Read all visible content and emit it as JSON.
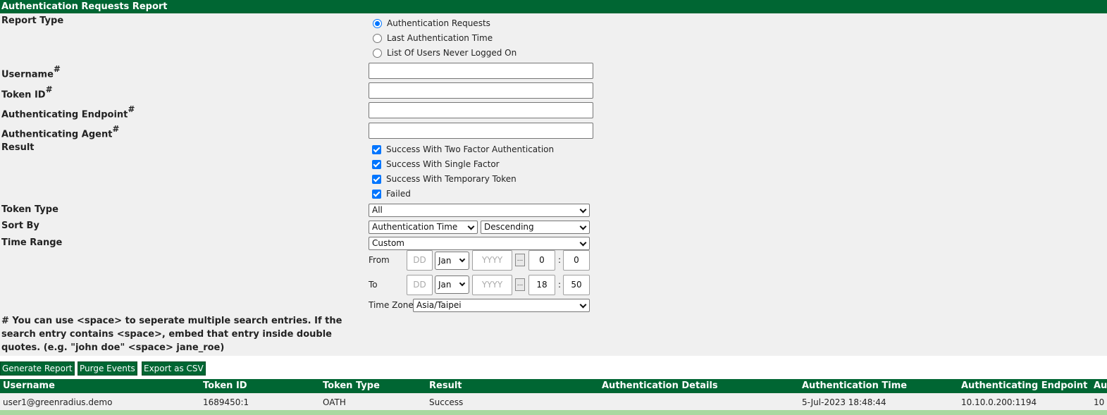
{
  "title": "Authentication Requests Report",
  "labels": {
    "report_type": "Report Type",
    "username": "Username",
    "token_id": "Token ID",
    "endpoint": "Authenticating Endpoint",
    "agent": "Authenticating Agent",
    "result": "Result",
    "token_type": "Token Type",
    "sort_by": "Sort By",
    "time_range": "Time Range",
    "hash": "#"
  },
  "report_types": [
    {
      "label": "Authentication Requests",
      "selected": true
    },
    {
      "label": "Last Authentication Time",
      "selected": false
    },
    {
      "label": "List Of Users Never Logged On",
      "selected": false
    }
  ],
  "fields": {
    "username": "",
    "token_id": "",
    "endpoint": "",
    "agent": ""
  },
  "results": [
    {
      "label": "Success With Two Factor Authentication",
      "checked": true
    },
    {
      "label": "Success With Single Factor",
      "checked": true
    },
    {
      "label": "Success With Temporary Token",
      "checked": true
    },
    {
      "label": "Failed",
      "checked": true
    }
  ],
  "token_type": "All",
  "sort_by": {
    "field": "Authentication Time",
    "order": "Descending"
  },
  "time_range": "Custom",
  "from": {
    "label": "From",
    "day_placeholder": "DD",
    "month": "Jan",
    "year_placeholder": "YYYY",
    "hour": "0",
    "minute": "0"
  },
  "to": {
    "label": "To",
    "day_placeholder": "DD",
    "month": "Jan",
    "year_placeholder": "YYYY",
    "hour": "18",
    "minute": "50"
  },
  "cal_glyph": "...",
  "colon": ":",
  "time_zone": {
    "label": "Time Zone",
    "value": "Asia/Taipei"
  },
  "note": "# You can use <space> to seperate multiple search entries. If the search entry contains <space>, embed that entry inside double quotes. (e.g. \"john doe\" <space> jane_roe)",
  "buttons": {
    "generate": "Generate Report",
    "purge": "Purge Events",
    "export": "Export as CSV"
  },
  "table": {
    "headers": [
      "Username",
      "Token ID",
      "Token Type",
      "Result",
      "Authentication Details",
      "Authentication Time",
      "Authenticating Endpoint",
      "Au"
    ],
    "rows": [
      [
        "user1@greenradius.demo",
        "1689450:1",
        "OATH",
        "Success",
        "",
        "5-Jul-2023 18:48:44",
        "10.10.0.200:1194",
        "10"
      ]
    ]
  }
}
